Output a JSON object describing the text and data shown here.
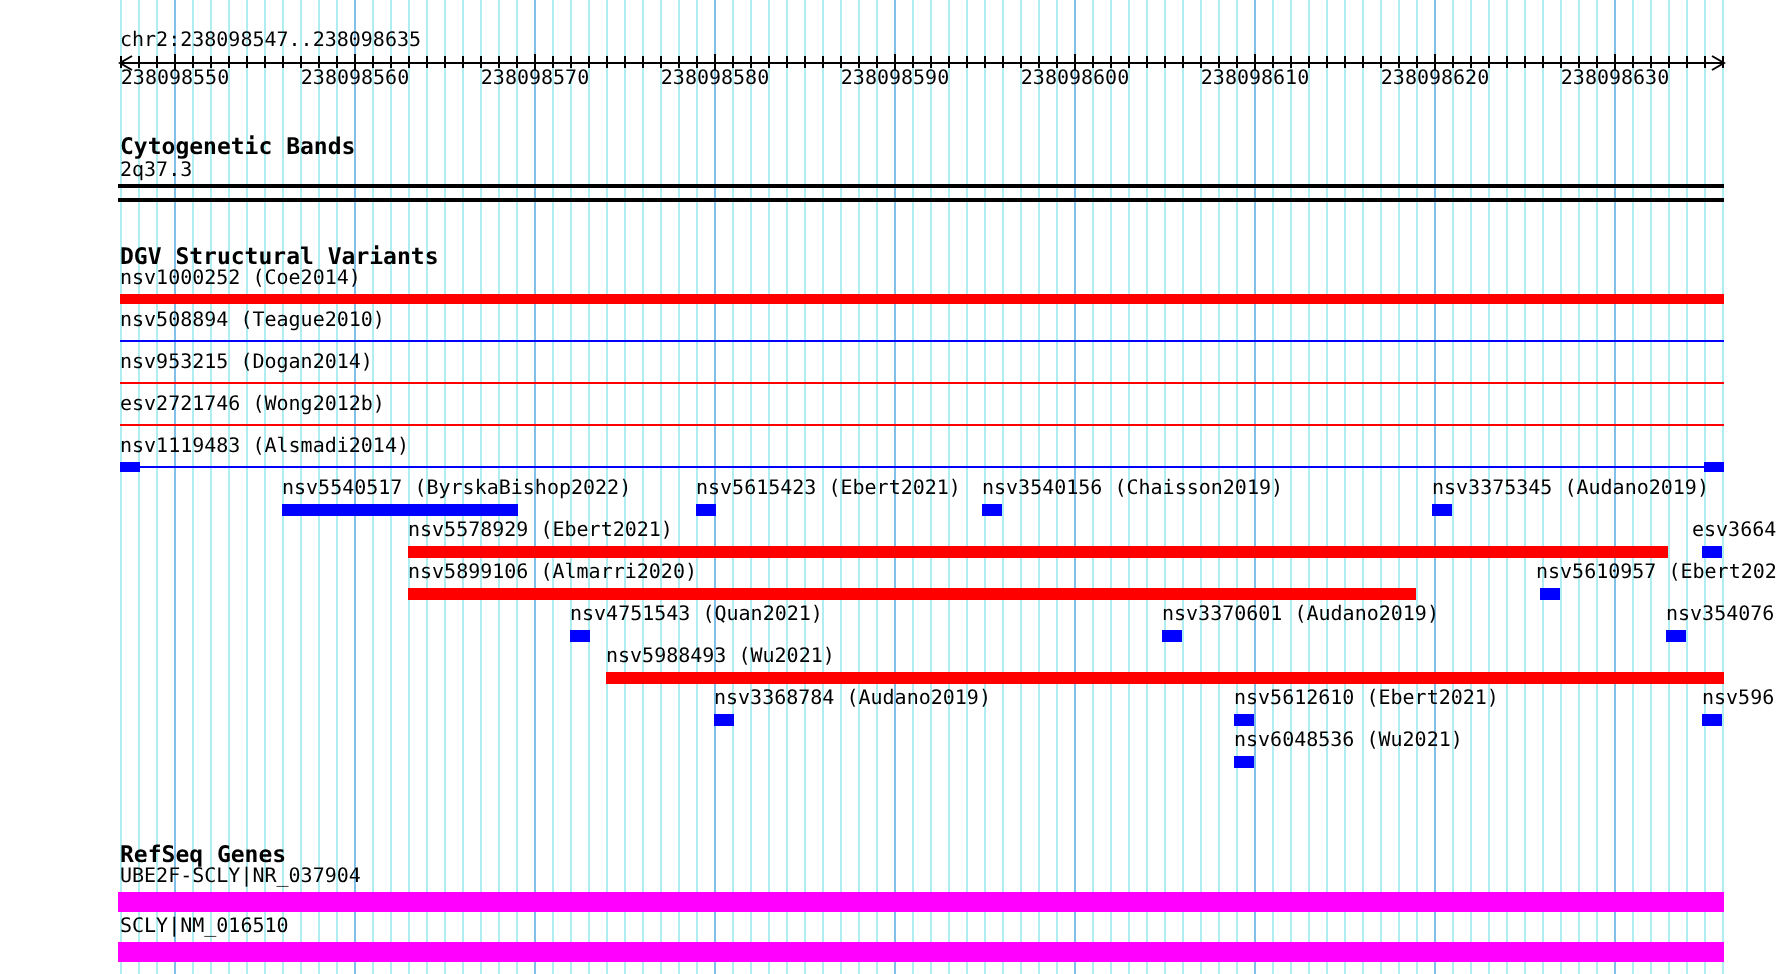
{
  "ruler": {
    "range": "chr2:238098547..238098635",
    "ticks": [
      "238098550",
      "238098560",
      "238098570",
      "238098580",
      "238098590",
      "238098600",
      "238098610",
      "238098620",
      "238098630"
    ]
  },
  "tracks": [
    {
      "kind": "cytoband",
      "title": "Cytogenetic Bands",
      "band": "2q37.3"
    },
    {
      "kind": "variants",
      "title": "DGV Structural Variants",
      "features": [
        {
          "label": "nsv1000252 (Coe2014)",
          "color": "#ff0000",
          "kind": "bar"
        },
        {
          "label": "nsv508894 (Teague2010)",
          "color": "#0000ff",
          "kind": "line"
        },
        {
          "label": "nsv953215 (Dogan2014)",
          "color": "#ff0000",
          "kind": "line"
        },
        {
          "label": "esv2721746 (Wong2012b)",
          "color": "#ff0000",
          "kind": "line"
        },
        {
          "label": "nsv1119483 (Alsmadi2014)",
          "color": "#0000ff",
          "kind": "line-ends"
        },
        {
          "label": "nsv5540517 (ByrskaBishop2022)",
          "color": "#0000ff",
          "kind": "bar"
        },
        {
          "label": "nsv5615423 (Ebert2021)",
          "color": "#0000ff",
          "kind": "bar"
        },
        {
          "label": "nsv3540156 (Chaisson2019)",
          "color": "#0000ff",
          "kind": "bar"
        },
        {
          "label": "nsv3375345 (Audano2019)",
          "color": "#0000ff",
          "kind": "bar"
        },
        {
          "label": "nsv5578929 (Ebert2021)",
          "color": "#ff0000",
          "kind": "bar"
        },
        {
          "label": "esv3664",
          "color": "#0000ff",
          "kind": "bar"
        },
        {
          "label": "nsv5899106 (Almarri2020)",
          "color": "#ff0000",
          "kind": "bar"
        },
        {
          "label": "nsv5610957 (Ebert202",
          "color": "#0000ff",
          "kind": "bar"
        },
        {
          "label": "nsv4751543 (Quan2021)",
          "color": "#0000ff",
          "kind": "bar"
        },
        {
          "label": "nsv3370601 (Audano2019)",
          "color": "#0000ff",
          "kind": "bar"
        },
        {
          "label": "nsv354076",
          "color": "#0000ff",
          "kind": "bar"
        },
        {
          "label": "nsv5988493 (Wu2021)",
          "color": "#ff0000",
          "kind": "bar"
        },
        {
          "label": "nsv3368784 (Audano2019)",
          "color": "#0000ff",
          "kind": "bar"
        },
        {
          "label": "nsv5612610 (Ebert2021)",
          "color": "#0000ff",
          "kind": "bar"
        },
        {
          "label": "nsv596",
          "color": "#0000ff",
          "kind": "bar"
        },
        {
          "label": "nsv6048536 (Wu2021)",
          "color": "#0000ff",
          "kind": "bar"
        }
      ]
    },
    {
      "kind": "genes",
      "title": "RefSeq Genes",
      "genes": [
        {
          "label": "UBE2F-SCLY|NR_037904"
        },
        {
          "label": "SCLY|NM_016510"
        }
      ]
    }
  ]
}
